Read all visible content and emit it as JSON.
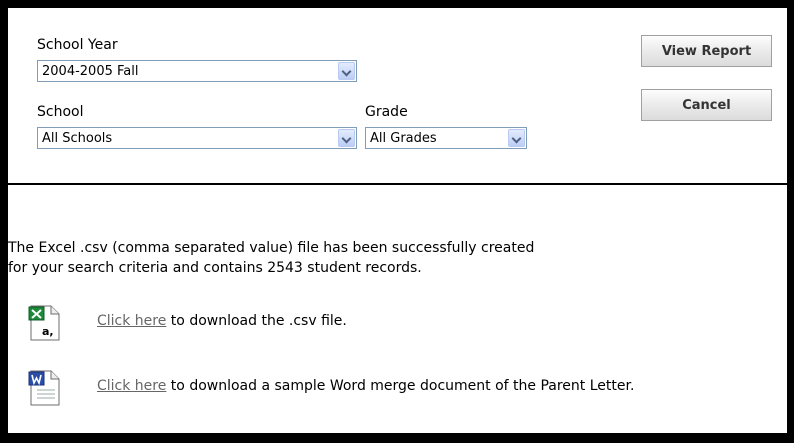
{
  "filters": {
    "school_year": {
      "label": "School Year",
      "value": "2004-2005 Fall"
    },
    "school": {
      "label": "School",
      "value": "All Schools"
    },
    "grade": {
      "label": "Grade",
      "value": "All Grades"
    }
  },
  "buttons": {
    "view_report": "View Report",
    "cancel": "Cancel"
  },
  "message": {
    "line1": "The Excel .csv (comma separated value) file has been successfully created",
    "line2": "for your search criteria and contains 2543 student records."
  },
  "downloads": [
    {
      "icon": "excel-csv-file-icon",
      "link": "Click here",
      "text": " to download the .csv file."
    },
    {
      "icon": "word-document-icon",
      "link": "Click here",
      "text": " to download a sample Word merge document of the Parent Letter."
    }
  ],
  "colors": {
    "select_border": "#7f9db9",
    "link": "#666666",
    "excel_green": "#1d8a3a",
    "word_blue": "#2b4fa8"
  }
}
